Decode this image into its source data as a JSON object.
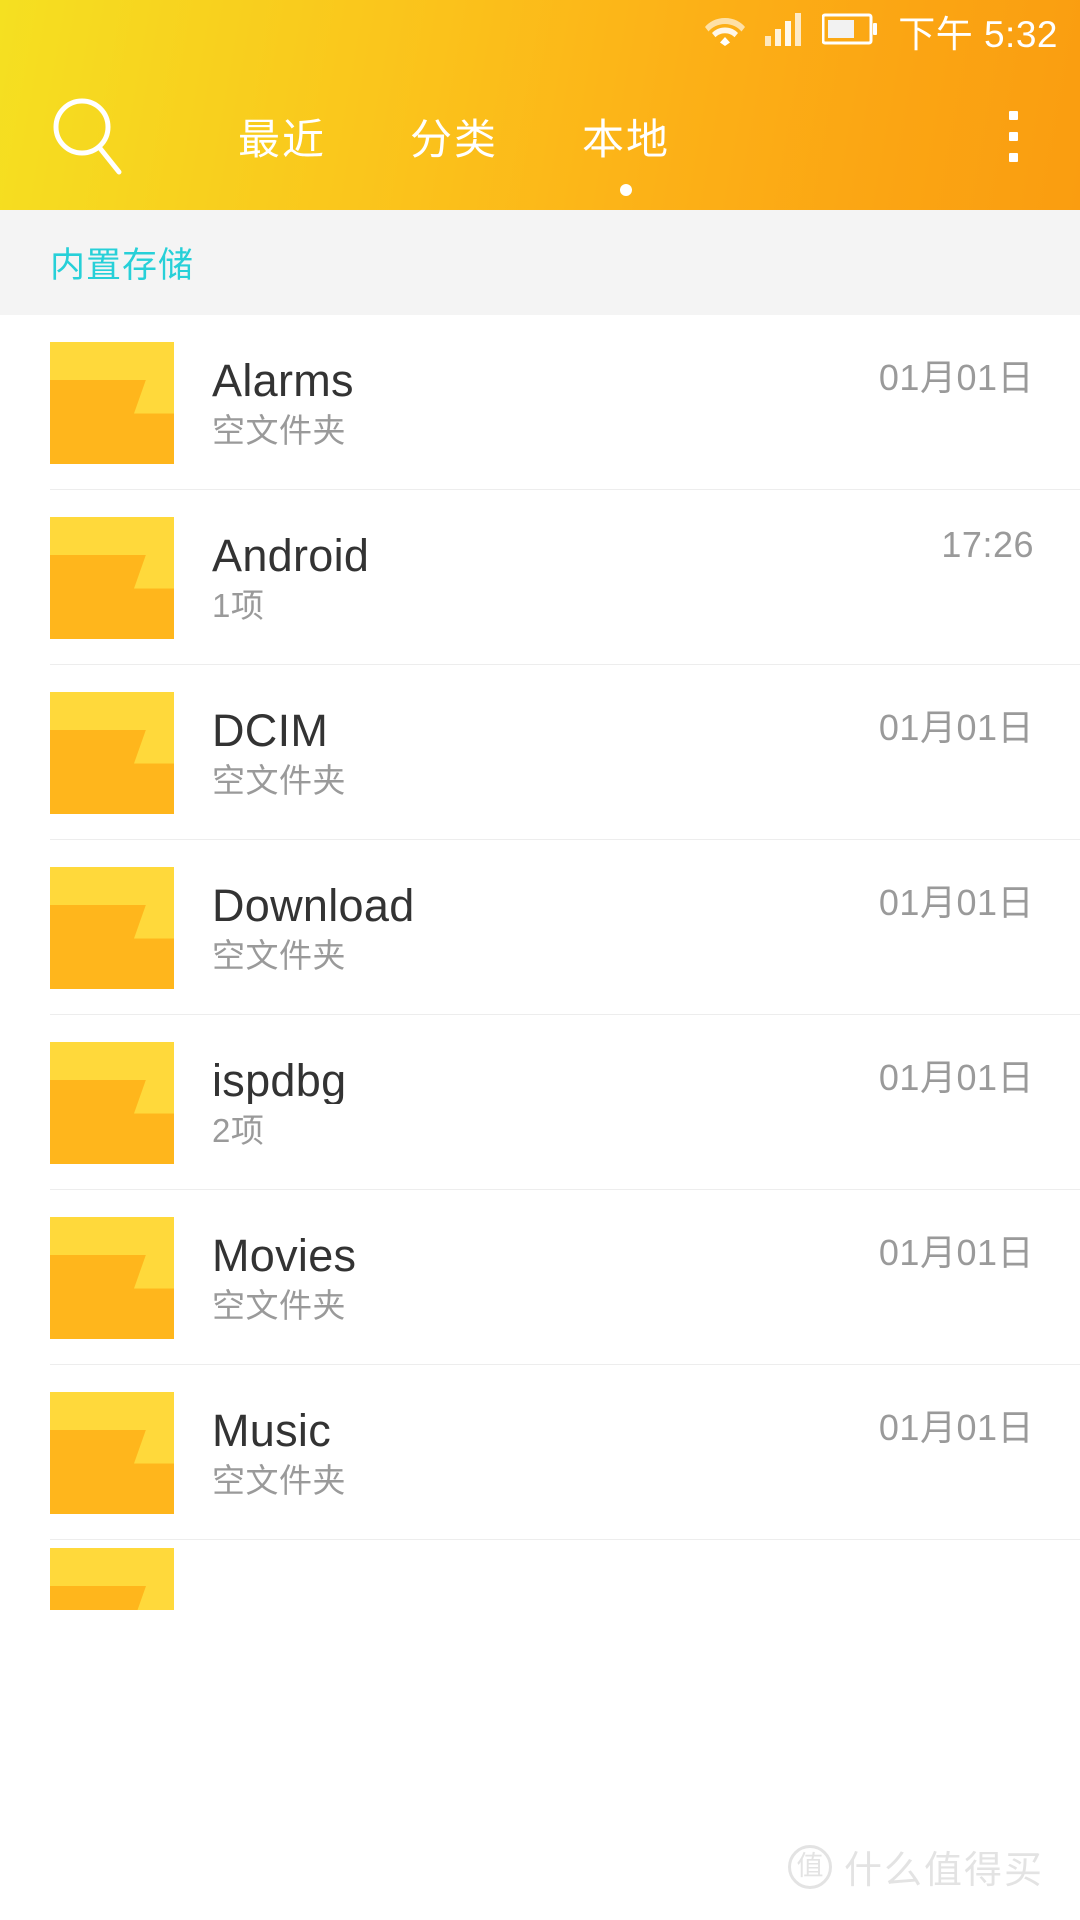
{
  "statusbar": {
    "time": "下午 5:32",
    "icons": [
      "wifi-icon",
      "signal-bars-icon",
      "battery-icon"
    ]
  },
  "appbar": {
    "search_icon": "search-icon",
    "overflow_icon": "overflow-menu-icon",
    "tabs": [
      {
        "label": "最近",
        "active": false
      },
      {
        "label": "分类",
        "active": false
      },
      {
        "label": "本地",
        "active": true
      }
    ]
  },
  "breadcrumb": {
    "path": "内置存储",
    "color": "#27d0d8"
  },
  "filelist": {
    "items": [
      {
        "name": "Alarms",
        "subtitle": "空文件夹",
        "date": "01月01日",
        "icon": "folder-icon"
      },
      {
        "name": "Android",
        "subtitle": "1项",
        "date": "17:26",
        "icon": "folder-icon"
      },
      {
        "name": "DCIM",
        "subtitle": "空文件夹",
        "date": "01月01日",
        "icon": "folder-icon"
      },
      {
        "name": "Download",
        "subtitle": "空文件夹",
        "date": "01月01日",
        "icon": "folder-icon"
      },
      {
        "name": "ispdbg",
        "subtitle": "2项",
        "date": "01月01日",
        "icon": "folder-icon"
      },
      {
        "name": "Movies",
        "subtitle": "空文件夹",
        "date": "01月01日",
        "icon": "folder-icon"
      },
      {
        "name": "Music",
        "subtitle": "空文件夹",
        "date": "01月01日",
        "icon": "folder-icon"
      },
      {
        "name": "",
        "subtitle": "",
        "date": "",
        "icon": "folder-icon"
      }
    ]
  },
  "watermark": {
    "logo": "值",
    "text": "什么值得买"
  },
  "colors": {
    "appbar_start": "#f5e021",
    "appbar_end": "#fa9d10",
    "accent_cyan": "#27d0d8",
    "folder_light": "#ffd93b",
    "folder_dark": "#ffb61c",
    "title_text": "#333333",
    "muted_text": "#9a9a9a",
    "breadcrumb_bg": "#f4f4f4"
  }
}
